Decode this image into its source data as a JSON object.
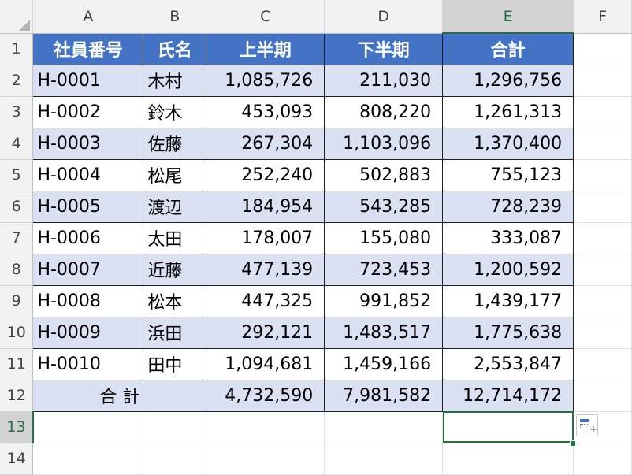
{
  "columns": [
    "A",
    "B",
    "C",
    "D",
    "E",
    "F"
  ],
  "rows": [
    "1",
    "2",
    "3",
    "4",
    "5",
    "6",
    "7",
    "8",
    "9",
    "10",
    "11",
    "12",
    "13",
    "14"
  ],
  "table": {
    "headers": [
      "社員番号",
      "氏名",
      "上半期",
      "下半期",
      "合計"
    ],
    "records": [
      [
        "H-0001",
        "木村",
        "1,085,726",
        "211,030",
        "1,296,756"
      ],
      [
        "H-0002",
        "鈴木",
        "453,093",
        "808,220",
        "1,261,313"
      ],
      [
        "H-0003",
        "佐藤",
        "267,304",
        "1,103,096",
        "1,370,400"
      ],
      [
        "H-0004",
        "松尾",
        "252,240",
        "502,883",
        "755,123"
      ],
      [
        "H-0005",
        "渡辺",
        "184,954",
        "543,285",
        "728,239"
      ],
      [
        "H-0006",
        "太田",
        "178,007",
        "155,080",
        "333,087"
      ],
      [
        "H-0007",
        "近藤",
        "477,139",
        "723,453",
        "1,200,592"
      ],
      [
        "H-0008",
        "松本",
        "447,325",
        "991,852",
        "1,439,177"
      ],
      [
        "H-0009",
        "浜田",
        "292,121",
        "1,483,517",
        "1,775,638"
      ],
      [
        "H-0010",
        "田中",
        "1,094,681",
        "1,459,166",
        "2,553,847"
      ]
    ],
    "total": {
      "label": "合 計",
      "c": "4,732,590",
      "d": "7,981,582",
      "e": "12,714,172"
    }
  },
  "selection": {
    "cell": "E13",
    "column": "E",
    "row": "13"
  },
  "colors": {
    "header_blue": "#4472c4",
    "band": "#d9e1f2",
    "select_green": "#217346"
  },
  "icons": {
    "quick_analysis": "quick-analysis-icon"
  }
}
